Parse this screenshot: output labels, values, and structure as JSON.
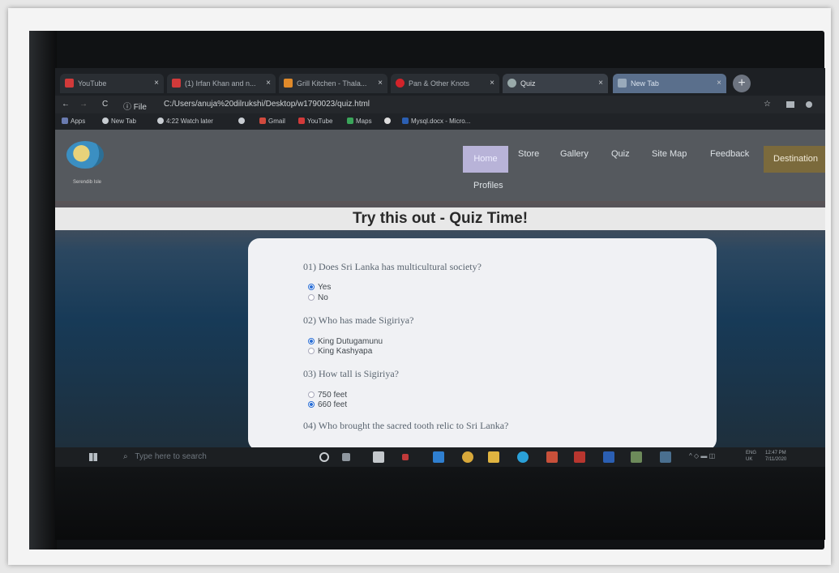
{
  "browser": {
    "tabs": [
      {
        "label": "YouTube",
        "icon": "youtube-icon",
        "color": "#d23a3a"
      },
      {
        "label": "(1) Irfan Khan and n...",
        "icon": "youtube-icon",
        "color": "#d23a3a"
      },
      {
        "label": "Grill Kitchen - Thala...",
        "icon": "fork-icon",
        "color": "#e08a2a"
      },
      {
        "label": "Pan & Other Knots",
        "icon": "pinterest-icon",
        "color": "#d2232a"
      },
      {
        "label": "Quiz",
        "icon": "globe-icon",
        "color": "#9aa"
      },
      {
        "label": "New Tab",
        "icon": "newtab-icon",
        "color": "#9ab"
      }
    ],
    "new_tab_symbol": "+",
    "close_symbol": "×",
    "address": {
      "back": "←",
      "forward": "→",
      "reload": "C",
      "scheme": "ⓘ File",
      "url": "C:/Users/anuja%20dilrukshi/Desktop/w1790023/quiz.html",
      "star": "☆"
    },
    "bookmarks": [
      "Apps",
      "New Tab",
      "4:22 Watch later",
      "Gmail",
      "YouTube",
      "Maps",
      "Mysql.docx - Micro..."
    ]
  },
  "site": {
    "logo_caption": "Serendib Isle",
    "nav": {
      "home": "Home",
      "store": "Store",
      "gallery": "Gallery",
      "quiz": "Quiz",
      "sitemap": "Site Map",
      "feedback": "Feedback",
      "destination": "Destination",
      "profiles": "Profiles"
    },
    "page_title": "Try this out - Quiz Time!"
  },
  "quiz": {
    "q1": {
      "question": "01) Does Sri Lanka has multicultural society?",
      "options": [
        "Yes",
        "No"
      ],
      "selected": 0
    },
    "q2": {
      "question": "02) Who has made Sigiriya?",
      "options": [
        "King Dutugamunu",
        "King Kashyapa"
      ],
      "selected": 0
    },
    "q3": {
      "question": "03) How tall is Sigiriya?",
      "options": [
        "750 feet",
        "660 feet"
      ],
      "selected": 1
    },
    "q4": {
      "question": "04) Who brought the sacred tooth relic to Sri Lanka?"
    }
  },
  "taskbar": {
    "search_placeholder": "Type here to search",
    "tray_lang": "ENG\nUK",
    "tray_time": "12:47 PM\n7/11/2020"
  },
  "colors": {
    "active_nav": "#b8b3d8",
    "destination_nav": "#7b6a3c",
    "radio_checked": "#2b6fd6"
  }
}
